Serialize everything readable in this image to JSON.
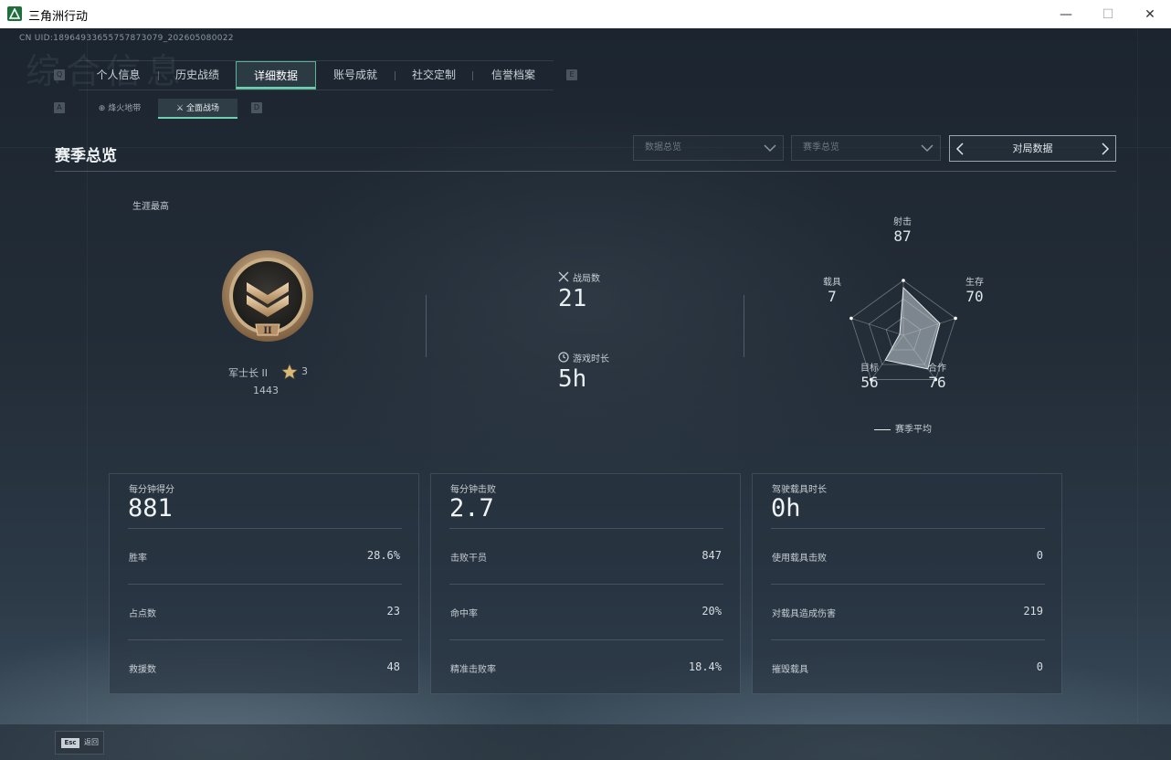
{
  "window": {
    "title": "三角洲行动",
    "min_symbol": "—",
    "max_symbol": "☐",
    "close_symbol": "✕"
  },
  "uid_text": "CN UID:1896493365575787307​9_202605080022",
  "ghost_title": "综合信息",
  "tabs": {
    "key_left": "Q",
    "key_right": "E",
    "items": [
      {
        "label": "个人信息"
      },
      {
        "label": "历史战绩"
      },
      {
        "label": "详细数据",
        "active": true
      },
      {
        "label": "账号成就"
      },
      {
        "label": "社交定制"
      },
      {
        "label": "信誉档案"
      }
    ]
  },
  "subtabs": {
    "key_left": "A",
    "key_right": "D",
    "items": [
      {
        "label": "烽火地带"
      },
      {
        "label": "全面战场",
        "active": true
      }
    ]
  },
  "section": {
    "title": "赛季总览"
  },
  "filters": {
    "dropdown1": "数据总览",
    "dropdown2": "赛季总览",
    "nav_label": "对局数据"
  },
  "career": {
    "label": "生涯最高",
    "rank_name": "军士长 II",
    "stars": "3",
    "score": "1443",
    "badge_numeral": "II"
  },
  "summary": {
    "matches_label": "战局数",
    "matches_value": "21",
    "playtime_label": "游戏时长",
    "playtime_value": "5h"
  },
  "radar": {
    "axes": [
      {
        "label": "射击",
        "value": "87",
        "score": 87
      },
      {
        "label": "生存",
        "value": "70",
        "score": 70
      },
      {
        "label": "合作",
        "value": "76",
        "score": 76
      },
      {
        "label": "目标",
        "value": "56",
        "score": 56
      },
      {
        "label": "载具",
        "value": "7",
        "score": 7
      }
    ],
    "legend": "赛季平均"
  },
  "cards": [
    {
      "title": "每分钟得分",
      "value": "881",
      "rows": [
        {
          "label": "胜率",
          "value": "28.6%"
        },
        {
          "label": "占点数",
          "value": "23"
        },
        {
          "label": "救援数",
          "value": "48"
        }
      ]
    },
    {
      "title": "每分钟击败",
      "value": "2.7",
      "rows": [
        {
          "label": "击败干员",
          "value": "847"
        },
        {
          "label": "命中率",
          "value": "20%"
        },
        {
          "label": "精准击败率",
          "value": "18.4%"
        }
      ]
    },
    {
      "title": "驾驶载具时长",
      "value": "0h",
      "rows": [
        {
          "label": "使用载具击败",
          "value": "0"
        },
        {
          "label": "对载具造成伤害",
          "value": "219"
        },
        {
          "label": "摧毁载具",
          "value": "0"
        }
      ]
    }
  ],
  "footer": {
    "esc_key": "Esc",
    "back_label": "返回"
  },
  "colors": {
    "accent": "#6fd0b0",
    "background": "#1b2430",
    "badge_gold": "#b8946a"
  }
}
